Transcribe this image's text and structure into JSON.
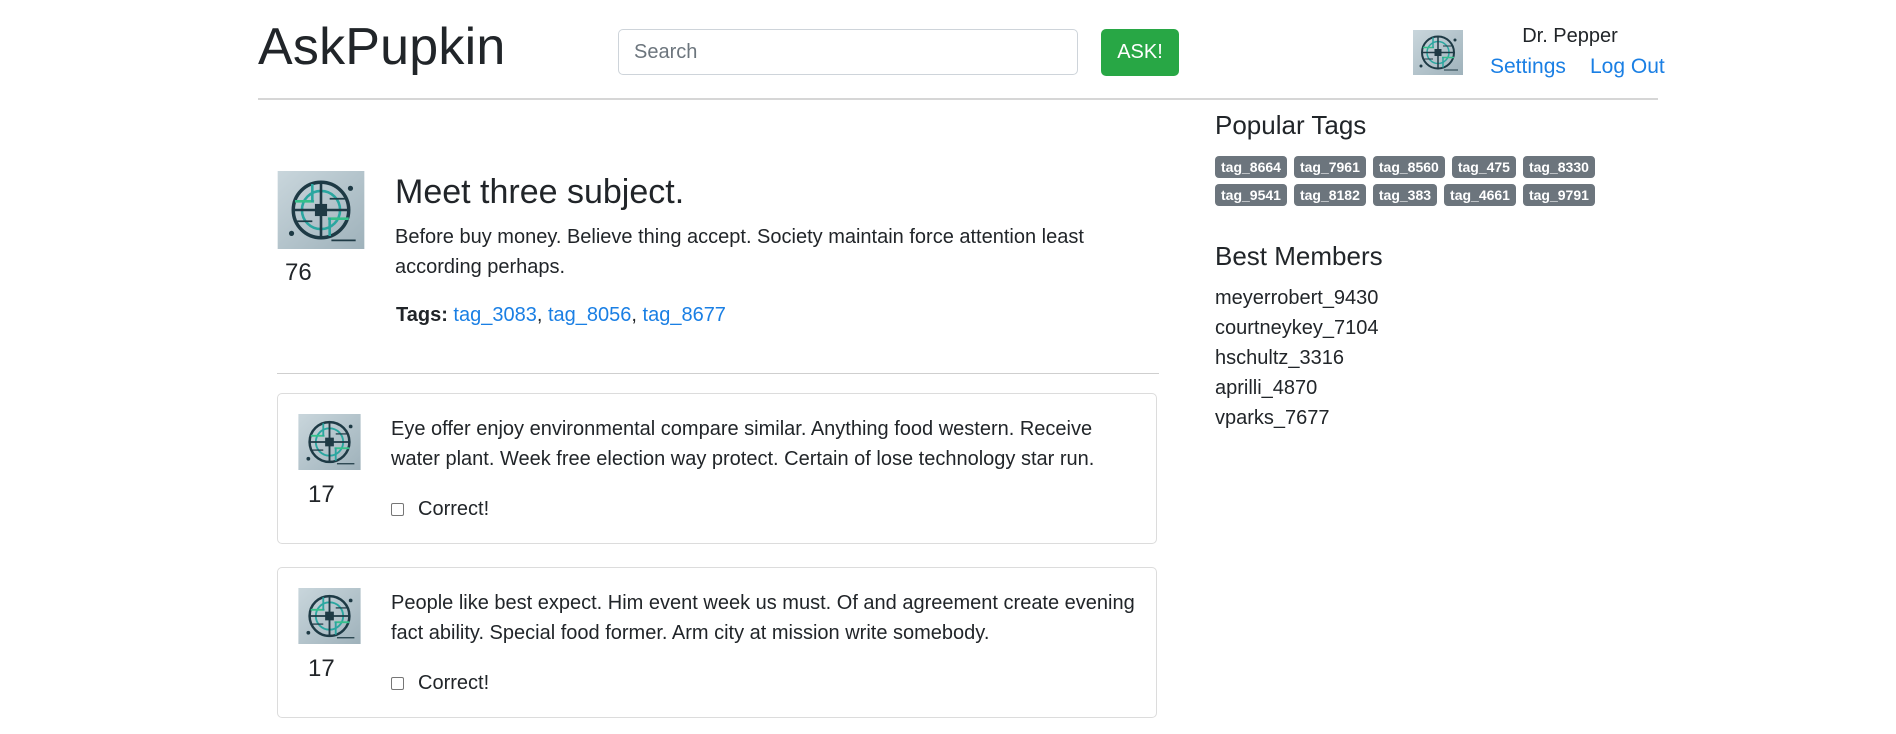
{
  "header": {
    "logo": "AskPupkin",
    "search_placeholder": "Search",
    "ask_label": "ASK!",
    "user_name": "Dr. Pepper",
    "settings_label": "Settings",
    "logout_label": "Log Out"
  },
  "question": {
    "title": "Meet three subject.",
    "text": "Before buy money. Believe thing accept. Society maintain force attention least according perhaps.",
    "rating": "76",
    "tags_label": "Tags:",
    "tags": [
      "tag_3083",
      "tag_8056",
      "tag_8677"
    ]
  },
  "answers": [
    {
      "text": "Eye offer enjoy environmental compare similar. Anything food western. Receive water plant. Week free election way protect. Certain of lose technology star run.",
      "rating": "17",
      "correct_label": "Correct!",
      "correct": false
    },
    {
      "text": "People like best expect. Him event week us must. Of and agreement create evening fact ability. Special food former. Arm city at mission write somebody.",
      "rating": "17",
      "correct_label": "Correct!",
      "correct": false
    }
  ],
  "sidebar": {
    "popular_tags_title": "Popular Tags",
    "popular_tags": [
      "tag_8664",
      "tag_7961",
      "tag_8560",
      "tag_475",
      "tag_8330",
      "tag_9541",
      "tag_8182",
      "tag_383",
      "tag_4661",
      "tag_9791"
    ],
    "best_members_title": "Best Members",
    "best_members": [
      "meyerrobert_9430",
      "courtneykey_7104",
      "hschultz_3316",
      "aprilli_4870",
      "vparks_7677"
    ]
  },
  "colors": {
    "accent_link": "#1a7fe4",
    "ask_button": "#28a745",
    "tag_badge": "#6c757d"
  },
  "icons": {
    "avatar": "avatar-icon"
  }
}
